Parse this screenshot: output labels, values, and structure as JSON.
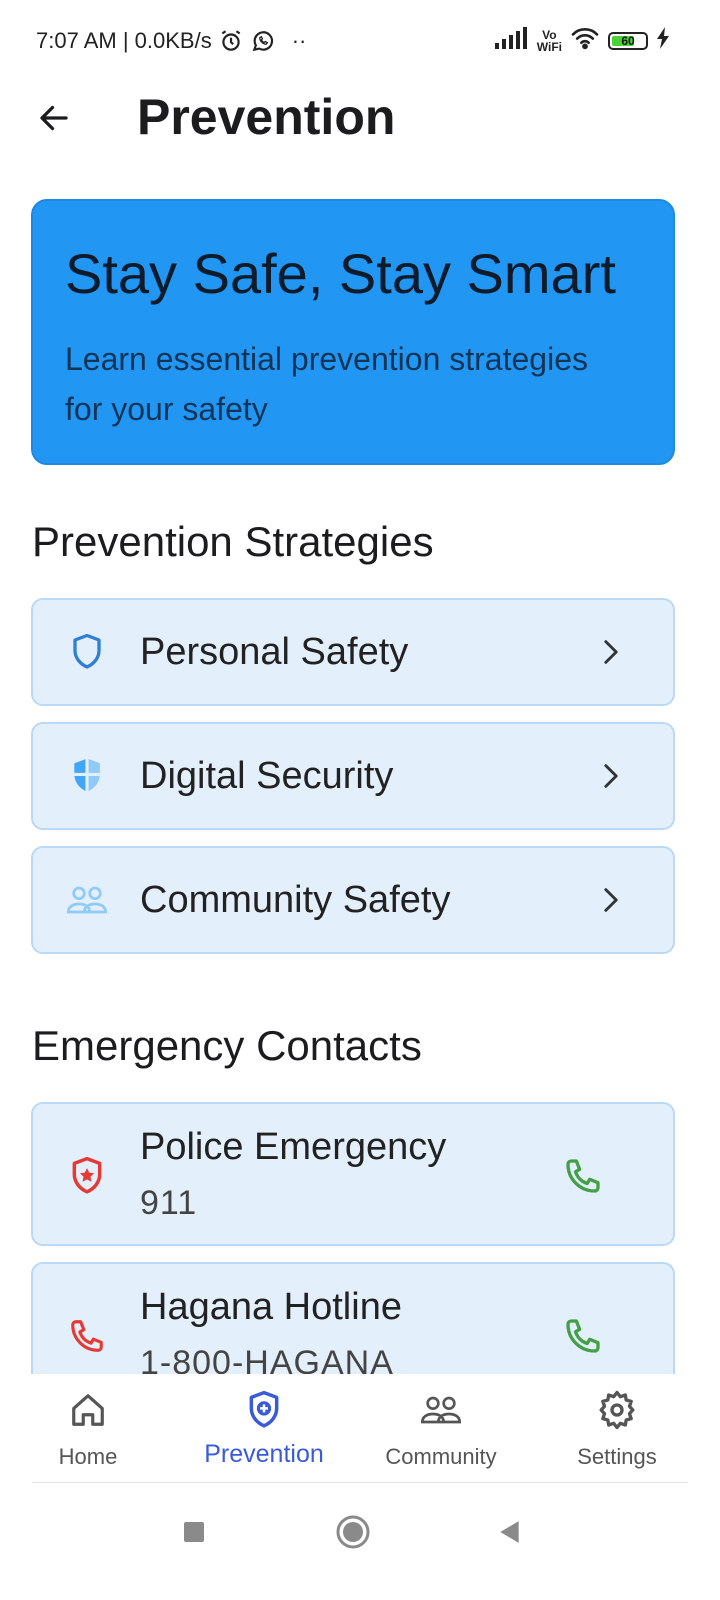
{
  "status_bar": {
    "time_speed": "7:07 AM | 0.0KB/s",
    "dots": "··",
    "vowifi_top": "Vo",
    "vowifi_bottom": "WiFi",
    "battery": "60"
  },
  "header": {
    "title": "Prevention"
  },
  "hero": {
    "title": "Stay Safe, Stay Smart",
    "subtitle": "Learn essential prevention strategies for your safety"
  },
  "strategies": {
    "section_title": "Prevention Strategies",
    "items": [
      {
        "label": "Personal Safety",
        "icon": "shield-outline-icon"
      },
      {
        "label": "Digital Security",
        "icon": "shield-half-icon"
      },
      {
        "label": "Community Safety",
        "icon": "people-icon"
      }
    ]
  },
  "contacts": {
    "section_title": "Emergency Contacts",
    "items": [
      {
        "name": "Police Emergency",
        "number": "911",
        "icon": "police-badge-icon"
      },
      {
        "name": "Hagana Hotline",
        "number": "1-800-HAGANA",
        "icon": "phone-icon"
      }
    ]
  },
  "bottom_nav": {
    "items": [
      {
        "label": "Home",
        "icon": "home-icon"
      },
      {
        "label": "Prevention",
        "icon": "shield-plus-icon",
        "active": true
      },
      {
        "label": "Community",
        "icon": "people-icon"
      },
      {
        "label": "Settings",
        "icon": "gear-icon"
      }
    ]
  },
  "colors": {
    "hero_bg": "#2196f3",
    "card_bg": "#e3f0fc",
    "accent": "#3a5bd9",
    "call_green": "#43a047",
    "alert_red": "#e53935"
  }
}
